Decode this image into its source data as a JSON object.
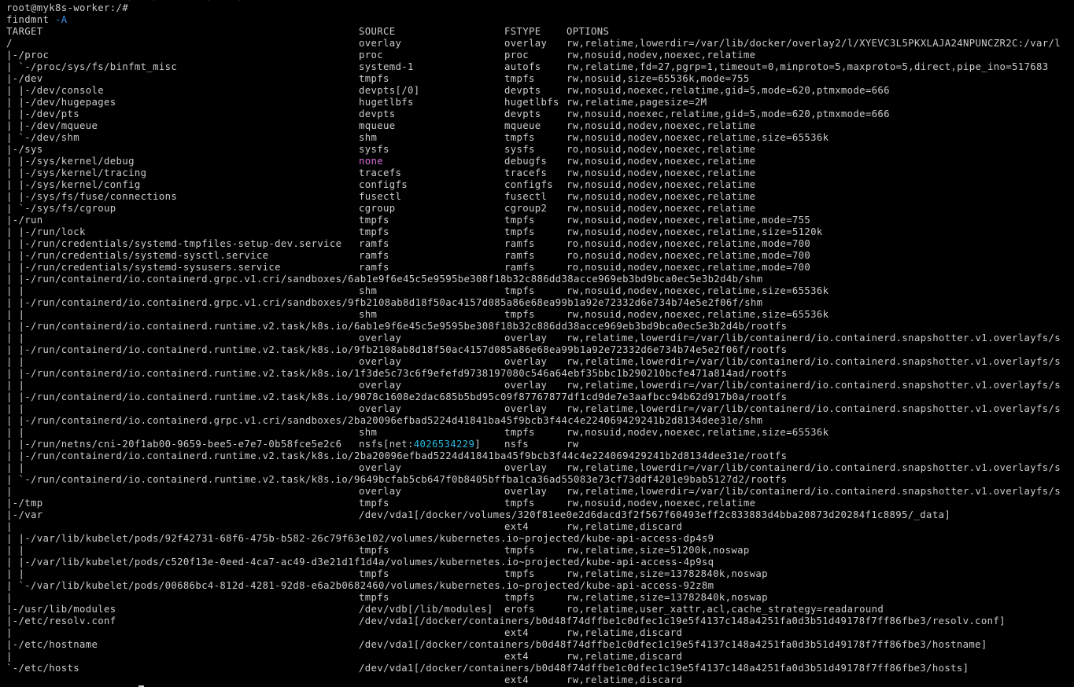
{
  "terminal": {
    "previous_line": "                    /   /        /    /",
    "prompt": "root@myk8s-worker:/#",
    "command": "findmnt",
    "command_flag": "-A",
    "headers": {
      "target": "TARGET",
      "source": "SOURCE",
      "fstype": "FSTYPE",
      "options": "OPTIONS"
    },
    "colors": {
      "background": "#000000",
      "text": "#cccccc",
      "flag": "#3b8eea",
      "none_source": "#d670d6",
      "nsfs_inode": "#29b8db"
    },
    "rows": [
      {
        "target": "/",
        "source": "overlay",
        "fstype": "overlay",
        "options": "rw,relatime,lowerdir=/var/lib/docker/overlay2/l/XYEVC3L5PKXLAJA24NPUNCZR2C:/var/l"
      },
      {
        "target": "|-/proc",
        "source": "proc",
        "fstype": "proc",
        "options": "rw,nosuid,nodev,noexec,relatime"
      },
      {
        "target": "| `-/proc/sys/fs/binfmt_misc",
        "source": "systemd-1",
        "fstype": "autofs",
        "options": "rw,relatime,fd=27,pgrp=1,timeout=0,minproto=5,maxproto=5,direct,pipe_ino=517683"
      },
      {
        "target": "|-/dev",
        "source": "tmpfs",
        "fstype": "tmpfs",
        "options": "rw,nosuid,size=65536k,mode=755"
      },
      {
        "target": "| |-/dev/console",
        "source": "devpts[/0]",
        "fstype": "devpts",
        "options": "rw,nosuid,noexec,relatime,gid=5,mode=620,ptmxmode=666"
      },
      {
        "target": "| |-/dev/hugepages",
        "source": "hugetlbfs",
        "fstype": "hugetlbfs",
        "options": "rw,relatime,pagesize=2M"
      },
      {
        "target": "| |-/dev/pts",
        "source": "devpts",
        "fstype": "devpts",
        "options": "rw,nosuid,noexec,relatime,gid=5,mode=620,ptmxmode=666"
      },
      {
        "target": "| |-/dev/mqueue",
        "source": "mqueue",
        "fstype": "mqueue",
        "options": "rw,nosuid,nodev,noexec,relatime"
      },
      {
        "target": "| `-/dev/shm",
        "source": "shm",
        "fstype": "tmpfs",
        "options": "rw,nosuid,nodev,noexec,relatime,size=65536k"
      },
      {
        "target": "|-/sys",
        "source": "sysfs",
        "fstype": "sysfs",
        "options": "ro,nosuid,nodev,noexec,relatime"
      },
      {
        "target": "| |-/sys/kernel/debug",
        "source": "none",
        "source_style": "magenta",
        "fstype": "debugfs",
        "options": "rw,nosuid,nodev,noexec,relatime"
      },
      {
        "target": "| |-/sys/kernel/tracing",
        "source": "tracefs",
        "fstype": "tracefs",
        "options": "rw,nosuid,nodev,noexec,relatime"
      },
      {
        "target": "| |-/sys/kernel/config",
        "source": "configfs",
        "fstype": "configfs",
        "options": "rw,nosuid,nodev,noexec,relatime"
      },
      {
        "target": "| |-/sys/fs/fuse/connections",
        "source": "fusectl",
        "fstype": "fusectl",
        "options": "rw,nosuid,nodev,noexec,relatime"
      },
      {
        "target": "| `-/sys/fs/cgroup",
        "source": "cgroup",
        "fstype": "cgroup2",
        "options": "rw,nosuid,nodev,noexec,relatime"
      },
      {
        "target": "|-/run",
        "source": "tmpfs",
        "fstype": "tmpfs",
        "options": "rw,nosuid,nodev,noexec,relatime,mode=755"
      },
      {
        "target": "| |-/run/lock",
        "source": "tmpfs",
        "fstype": "tmpfs",
        "options": "rw,nosuid,nodev,noexec,relatime,size=5120k"
      },
      {
        "target": "| |-/run/credentials/systemd-tmpfiles-setup-dev.service",
        "source": "ramfs",
        "fstype": "ramfs",
        "options": "ro,nosuid,nodev,noexec,relatime,mode=700"
      },
      {
        "target": "| |-/run/credentials/systemd-sysctl.service",
        "source": "ramfs",
        "fstype": "ramfs",
        "options": "ro,nosuid,nodev,noexec,relatime,mode=700"
      },
      {
        "target": "| |-/run/credentials/systemd-sysusers.service",
        "source": "ramfs",
        "fstype": "ramfs",
        "options": "ro,nosuid,nodev,noexec,relatime,mode=700"
      },
      {
        "target": "| |-/run/containerd/io.containerd.grpc.v1.cri/sandboxes/6ab1e9f6e45c5e9595be308f18b32c886dd38acce969eb3bd9bca0ec5e3b2d4b/shm",
        "source": "",
        "fstype": "",
        "options": ""
      },
      {
        "target": "| |",
        "source": "shm",
        "fstype": "tmpfs",
        "options": "rw,nosuid,nodev,noexec,relatime,size=65536k"
      },
      {
        "target": "| |-/run/containerd/io.containerd.grpc.v1.cri/sandboxes/9fb2108ab8d18f50ac4157d085a86e68ea99b1a92e72332d6e734b74e5e2f06f/shm",
        "source": "",
        "fstype": "",
        "options": ""
      },
      {
        "target": "| |",
        "source": "shm",
        "fstype": "tmpfs",
        "options": "rw,nosuid,nodev,noexec,relatime,size=65536k"
      },
      {
        "target": "| |-/run/containerd/io.containerd.runtime.v2.task/k8s.io/6ab1e9f6e45c5e9595be308f18b32c886dd38acce969eb3bd9bca0ec5e3b2d4b/rootfs",
        "source": "",
        "fstype": "",
        "options": ""
      },
      {
        "target": "| |",
        "source": "overlay",
        "fstype": "overlay",
        "options": "rw,relatime,lowerdir=/var/lib/containerd/io.containerd.snapshotter.v1.overlayfs/s"
      },
      {
        "target": "| |-/run/containerd/io.containerd.runtime.v2.task/k8s.io/9fb2108ab8d18f50ac4157d085a86e68ea99b1a92e72332d6e734b74e5e2f06f/rootfs",
        "source": "",
        "fstype": "",
        "options": ""
      },
      {
        "target": "| |",
        "source": "overlay",
        "fstype": "overlay",
        "options": "rw,relatime,lowerdir=/var/lib/containerd/io.containerd.snapshotter.v1.overlayfs/s"
      },
      {
        "target": "| |-/run/containerd/io.containerd.runtime.v2.task/k8s.io/1f3de5c73c6f9efefd9738197080c546a64ebf35bbc1b290210bcfe471a814ad/rootfs",
        "source": "",
        "fstype": "",
        "options": ""
      },
      {
        "target": "| |",
        "source": "overlay",
        "fstype": "overlay",
        "options": "rw,relatime,lowerdir=/var/lib/containerd/io.containerd.snapshotter.v1.overlayfs/s"
      },
      {
        "target": "| |-/run/containerd/io.containerd.runtime.v2.task/k8s.io/9078c1608e2dac685b5bd95c09f87767877df1cd9de7e3aafbcc94b62d917b0a/rootfs",
        "source": "",
        "fstype": "",
        "options": ""
      },
      {
        "target": "| |",
        "source": "overlay",
        "fstype": "overlay",
        "options": "rw,relatime,lowerdir=/var/lib/containerd/io.containerd.snapshotter.v1.overlayfs/s"
      },
      {
        "target": "| |-/run/containerd/io.containerd.grpc.v1.cri/sandboxes/2ba20096efbad5224d41841ba45f9bcb3f44c4e224069429241b2d8134dee31e/shm",
        "source": "",
        "fstype": "",
        "options": ""
      },
      {
        "target": "| |",
        "source": "shm",
        "fstype": "tmpfs",
        "options": "rw,nosuid,nodev,noexec,relatime,size=65536k"
      },
      {
        "target": "| |-/run/netns/cni-20f1ab00-9659-bee5-e7e7-0b58fce5e2c6",
        "source": "nsfs[net:",
        "source_inode": "4026534229",
        "source_suffix": "]",
        "fstype": "nsfs",
        "options": "rw"
      },
      {
        "target": "| |-/run/containerd/io.containerd.runtime.v2.task/k8s.io/2ba20096efbad5224d41841ba45f9bcb3f44c4e224069429241b2d8134dee31e/rootfs",
        "source": "",
        "fstype": "",
        "options": ""
      },
      {
        "target": "| |",
        "source": "overlay",
        "fstype": "overlay",
        "options": "rw,relatime,lowerdir=/var/lib/containerd/io.containerd.snapshotter.v1.overlayfs/s"
      },
      {
        "target": "| `-/run/containerd/io.containerd.runtime.v2.task/k8s.io/9649bcfab5cb647f0b8405bffba1ca36ad55083e73cf73ddf4201e9bab5127d2/rootfs",
        "source": "",
        "fstype": "",
        "options": ""
      },
      {
        "target": "|",
        "source": "overlay",
        "fstype": "overlay",
        "options": "rw,relatime,lowerdir=/var/lib/containerd/io.containerd.snapshotter.v1.overlayfs/s"
      },
      {
        "target": "|-/tmp",
        "source": "tmpfs",
        "fstype": "tmpfs",
        "options": "rw,nosuid,nodev,noexec,relatime"
      },
      {
        "target": "|-/var",
        "source": "/dev/vda1[/docker/volumes/320f81ee0e2d6dacd3f2f567f60493eff2c833883d4bba20873d20284f1c8895/_data]",
        "fstype": "",
        "options": ""
      },
      {
        "target": "|",
        "source": "",
        "fstype": "ext4",
        "options": "rw,relatime,discard"
      },
      {
        "target": "| |-/var/lib/kubelet/pods/92f42731-68f6-475b-b582-26c79f63e102/volumes/kubernetes.io~projected/kube-api-access-dp4s9",
        "source": "",
        "fstype": "",
        "options": ""
      },
      {
        "target": "| |",
        "source": "tmpfs",
        "fstype": "tmpfs",
        "options": "rw,relatime,size=51200k,noswap"
      },
      {
        "target": "| |-/var/lib/kubelet/pods/c520f13e-0eed-4ca7-ac49-d3e21d1f1d4a/volumes/kubernetes.io~projected/kube-api-access-4p9sq",
        "source": "",
        "fstype": "",
        "options": ""
      },
      {
        "target": "| |",
        "source": "tmpfs",
        "fstype": "tmpfs",
        "options": "rw,relatime,size=13782840k,noswap"
      },
      {
        "target": "| `-/var/lib/kubelet/pods/00686bc4-812d-4281-92d8-e6a2b0682460/volumes/kubernetes.io~projected/kube-api-access-92z8m",
        "source": "",
        "fstype": "",
        "options": ""
      },
      {
        "target": "|",
        "source": "tmpfs",
        "fstype": "tmpfs",
        "options": "rw,relatime,size=13782840k,noswap"
      },
      {
        "target": "|-/usr/lib/modules",
        "source": "/dev/vdb[/lib/modules]",
        "fstype": "erofs",
        "options": "ro,relatime,user_xattr,acl,cache_strategy=readaround"
      },
      {
        "target": "|-/etc/resolv.conf",
        "source": "/dev/vda1[/docker/containers/b0d48f74dffbe1c0dfec1c19e5f4137c148a4251fa0d3b51d49178f7ff86fbe3/resolv.conf]",
        "fstype": "",
        "options": ""
      },
      {
        "target": "|",
        "source": "",
        "fstype": "ext4",
        "options": "rw,relatime,discard"
      },
      {
        "target": "|-/etc/hostname",
        "source": "/dev/vda1[/docker/containers/b0d48f74dffbe1c0dfec1c19e5f4137c148a4251fa0d3b51d49178f7ff86fbe3/hostname]",
        "fstype": "",
        "options": ""
      },
      {
        "target": "|",
        "source": "",
        "fstype": "ext4",
        "options": "rw,relatime,discard"
      },
      {
        "target": "`-/etc/hosts",
        "source": "/dev/vda1[/docker/containers/b0d48f74dffbe1c0dfec1c19e5f4137c148a4251fa0d3b51d49178f7ff86fbe3/hosts]",
        "fstype": "",
        "options": ""
      },
      {
        "target": "",
        "source": "",
        "fstype": "ext4",
        "options": "rw,relatime,discard"
      }
    ]
  }
}
